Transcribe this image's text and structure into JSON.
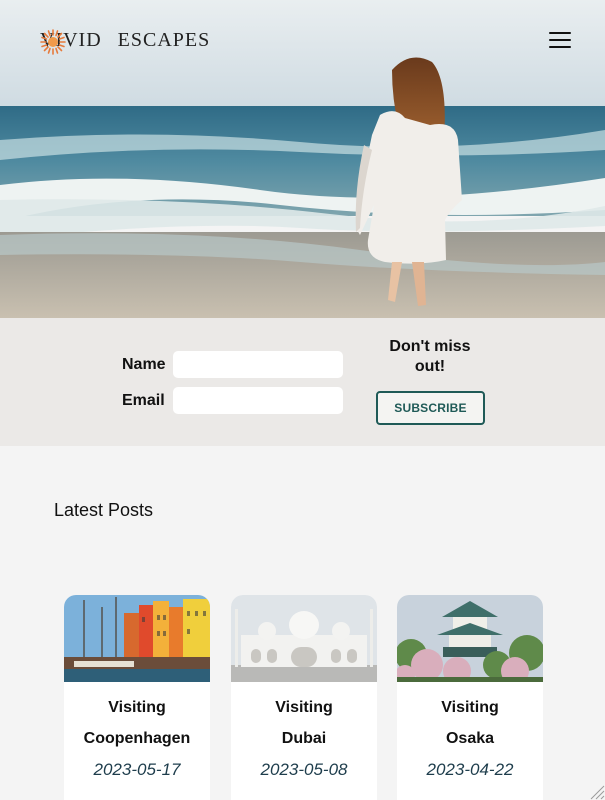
{
  "header": {
    "logo_left": "VIVID",
    "logo_right": "ESCAPES",
    "logo_icon": "sun-icon",
    "menu_icon": "hamburger-menu-icon"
  },
  "subscribe": {
    "name_label": "Name",
    "email_label": "Email",
    "name_value": "",
    "email_value": "",
    "cta_line1": "Don't miss",
    "cta_line2": "out!",
    "button_label": "SUBSCRIBE",
    "accent_color": "#1f5a57"
  },
  "posts": {
    "title": "Latest Posts",
    "items": [
      {
        "line1": "Visiting",
        "line2": "Coopenhagen",
        "date": "2023-05-17"
      },
      {
        "line1": "Visiting",
        "line2": "Dubai",
        "date": "2023-05-08"
      },
      {
        "line1": "Visiting",
        "line2": "Osaka",
        "date": "2023-04-22"
      }
    ]
  }
}
